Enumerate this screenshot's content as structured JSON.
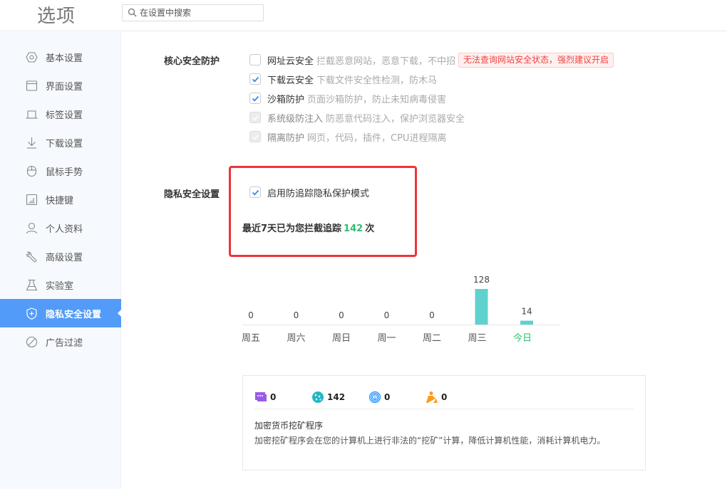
{
  "header": {
    "title": "选项",
    "search_placeholder": "在设置中搜索"
  },
  "sidebar": {
    "items": [
      {
        "label": "基本设置",
        "icon": "hexagon-settings-icon",
        "active": false
      },
      {
        "label": "界面设置",
        "icon": "window-icon",
        "active": false
      },
      {
        "label": "标签设置",
        "icon": "tab-icon",
        "active": false
      },
      {
        "label": "下载设置",
        "icon": "download-icon",
        "active": false
      },
      {
        "label": "鼠标手势",
        "icon": "mouse-icon",
        "active": false
      },
      {
        "label": "快捷键",
        "icon": "shortcut-icon",
        "active": false
      },
      {
        "label": "个人资料",
        "icon": "user-icon",
        "active": false
      },
      {
        "label": "高级设置",
        "icon": "wrench-icon",
        "active": false
      },
      {
        "label": "实验室",
        "icon": "flask-icon",
        "active": false
      },
      {
        "label": "隐私安全设置",
        "icon": "shield-plus-icon",
        "active": true
      },
      {
        "label": "广告过滤",
        "icon": "block-icon",
        "active": false
      }
    ]
  },
  "core": {
    "label": "核心安全防护",
    "options": [
      {
        "title": "网址云安全",
        "desc": "拦截恶意网站，恶意下载，不中招",
        "checked": false,
        "disabled": false,
        "warning": "无法查询网站安全状态，强烈建议开启"
      },
      {
        "title": "下载云安全",
        "desc": "下载文件安全性检测，防木马",
        "checked": true,
        "disabled": false
      },
      {
        "title": "沙箱防护",
        "desc": "页面沙箱防护，防止未知病毒侵害",
        "checked": true,
        "disabled": false
      },
      {
        "title": "系统级防注入",
        "desc": "防恶意代码注入，保护浏览器安全",
        "checked": true,
        "disabled": true
      },
      {
        "title": "隔离防护",
        "desc": "网页，代码，插件，CPU进程隔离",
        "checked": true,
        "disabled": true
      }
    ]
  },
  "privacy": {
    "label": "隐私安全设置",
    "option_label": "启用防追踪隐私保护模式",
    "option_checked": true,
    "stat_prefix": "最近7天已为您拦截追踪",
    "stat_count": "142",
    "stat_suffix": "次"
  },
  "chart_data": {
    "type": "bar",
    "categories": [
      "周五",
      "周六",
      "周日",
      "周一",
      "周二",
      "周三",
      "今日"
    ],
    "values": [
      0,
      0,
      0,
      0,
      0,
      128,
      14
    ],
    "highlight_category": "今日",
    "bar_color": "#5fd1cf",
    "highlight_color": "#2ebd6e",
    "title": "",
    "xlabel": "",
    "ylabel": "",
    "ylim": [
      0,
      128
    ],
    "grid": false
  },
  "tracker_stats": {
    "items": [
      {
        "icon": "chat-ad-icon",
        "value": "0",
        "color": "#9a5ae8"
      },
      {
        "icon": "cookie-icon",
        "value": "142",
        "color": "#1fb8c4"
      },
      {
        "icon": "fingerprint-icon",
        "value": "0",
        "color": "#1e90ff"
      },
      {
        "icon": "miner-icon",
        "value": "0",
        "color": "#ff9a1a"
      }
    ],
    "detail_title": "加密货币挖矿程序",
    "detail_desc": "加密挖矿程序会在您的计算机上进行非法的“挖矿”计算，降低计算机性能，消耗计算机电力。"
  }
}
